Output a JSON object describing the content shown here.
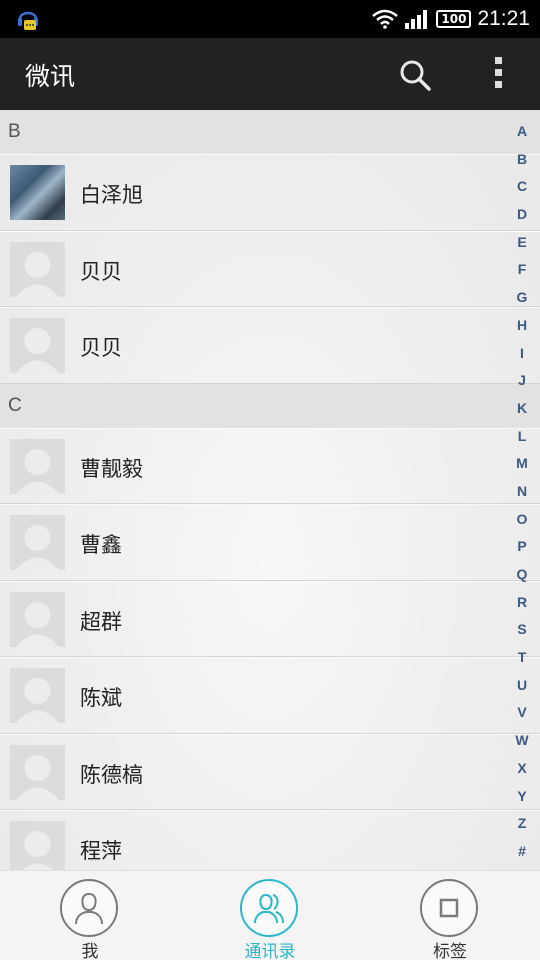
{
  "status_bar": {
    "left_icon": "qq-notification-icon",
    "battery": "100",
    "time": "21:21"
  },
  "app_bar": {
    "title": "微讯",
    "search_icon": "search-icon",
    "more_icon": "more-vert-icon"
  },
  "sections": [
    {
      "letter": "B",
      "contacts": [
        {
          "name": "白泽旭",
          "avatar": "photo"
        },
        {
          "name": "贝贝",
          "avatar": "default"
        },
        {
          "name": "贝贝",
          "avatar": "default"
        }
      ]
    },
    {
      "letter": "C",
      "contacts": [
        {
          "name": "曹靓毅",
          "avatar": "default"
        },
        {
          "name": "曹鑫",
          "avatar": "default"
        },
        {
          "name": "超群",
          "avatar": "default"
        },
        {
          "name": "陈斌",
          "avatar": "default"
        },
        {
          "name": "陈德槁",
          "avatar": "default"
        },
        {
          "name": "程萍",
          "avatar": "default"
        }
      ]
    }
  ],
  "index_letters": [
    "A",
    "B",
    "C",
    "D",
    "E",
    "F",
    "G",
    "H",
    "I",
    "J",
    "K",
    "L",
    "M",
    "N",
    "O",
    "P",
    "Q",
    "R",
    "S",
    "T",
    "U",
    "V",
    "W",
    "X",
    "Y",
    "Z",
    "#"
  ],
  "bottom_nav": {
    "items": [
      {
        "label": "我",
        "icon": "person-icon"
      },
      {
        "label": "通讯录",
        "icon": "contacts-icon"
      },
      {
        "label": "标签",
        "icon": "tag-square-icon"
      }
    ],
    "active_index": 1
  },
  "colors": {
    "accent": "#2ab7c9",
    "app_bar": "#222222",
    "index_letter": "#3b5a82"
  }
}
